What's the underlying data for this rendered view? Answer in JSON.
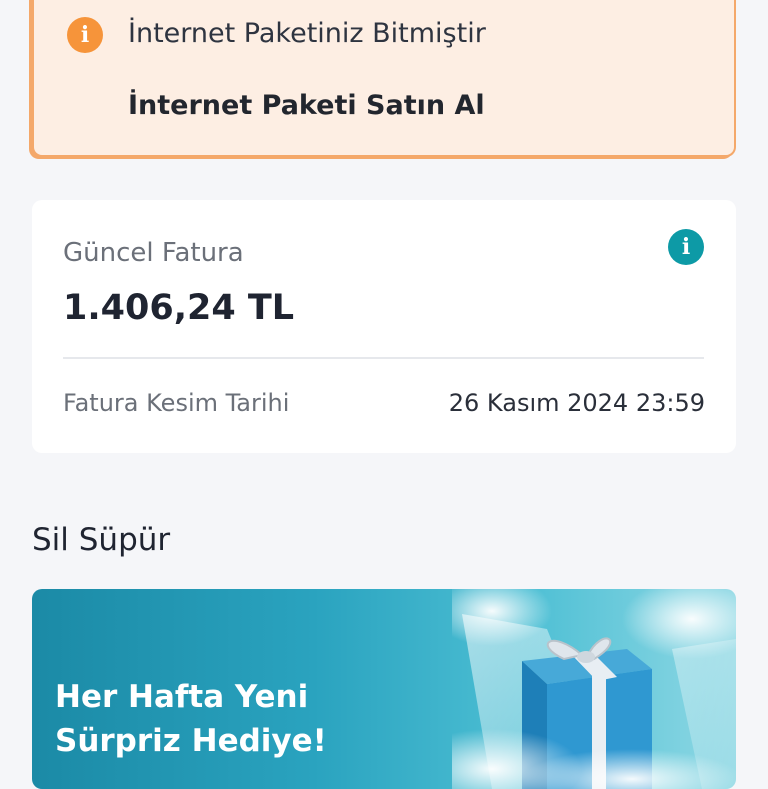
{
  "alert": {
    "message": "İnternet Paketiniz Bitmiştir",
    "action": "İnternet Paketi Satın Al",
    "icon": "info-icon",
    "color": "#f6943a"
  },
  "bill": {
    "label": "Güncel Fatura",
    "amount": "1.406,24 TL",
    "cut_label": "Fatura Kesim Tarihi",
    "cut_date": "26 Kasım 2024 23:59",
    "info_icon": "info-icon",
    "accent": "#0d9aa6"
  },
  "promo": {
    "section_title": "Sil Süpür",
    "banner_line1": "Her Hafta Yeni",
    "banner_line2": "Sürpriz Hediye!",
    "art": "gift-box-illustration"
  }
}
